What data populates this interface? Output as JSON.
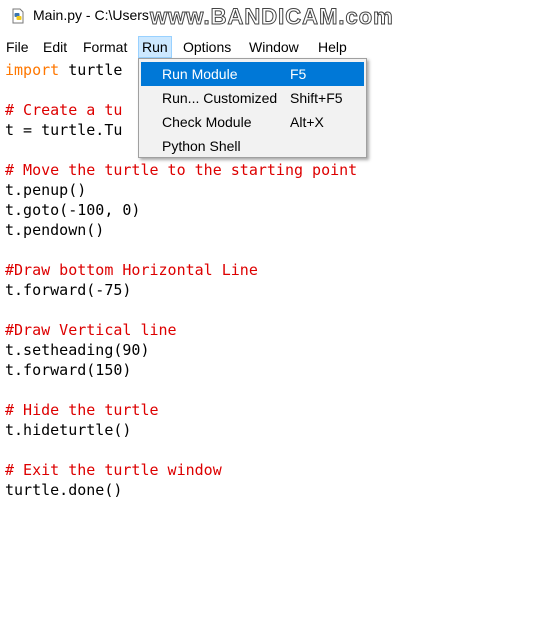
{
  "window": {
    "title": "Main.py - C:\\Users",
    "watermark": "www.BANDICAM.com"
  },
  "menubar": {
    "items": [
      {
        "label": "File"
      },
      {
        "label": "Edit"
      },
      {
        "label": "Format"
      },
      {
        "label": "Run"
      },
      {
        "label": "Options"
      },
      {
        "label": "Window"
      },
      {
        "label": "Help"
      }
    ]
  },
  "run_menu": {
    "items": [
      {
        "label": "Run Module",
        "accelerator": "F5"
      },
      {
        "label": "Run... Customized",
        "accelerator": "Shift+F5"
      },
      {
        "label": "Check Module",
        "accelerator": "Alt+X"
      },
      {
        "label": "Python Shell",
        "accelerator": ""
      }
    ]
  },
  "editor": {
    "lines": [
      {
        "kw": "import",
        "text": " turtle"
      },
      {
        "cm": "",
        "text": ""
      },
      {
        "cm": "# Create a tu",
        "text": ""
      },
      {
        "cm": "",
        "text": "t = turtle.Tu"
      },
      {
        "cm": "",
        "text": ""
      },
      {
        "cm": "# Move the turtle to the starting point",
        "text": ""
      },
      {
        "cm": "",
        "text": "t.penup()"
      },
      {
        "cm": "",
        "text": "t.goto(-100, 0)"
      },
      {
        "cm": "",
        "text": "t.pendown()"
      },
      {
        "cm": "",
        "text": ""
      },
      {
        "cm": "#Draw bottom Horizontal Line",
        "text": ""
      },
      {
        "cm": "",
        "text": "t.forward(-75)"
      },
      {
        "cm": "",
        "text": ""
      },
      {
        "cm": "#Draw Vertical line",
        "text": ""
      },
      {
        "cm": "",
        "text": "t.setheading(90)"
      },
      {
        "cm": "",
        "text": "t.forward(150)"
      },
      {
        "cm": "",
        "text": ""
      },
      {
        "cm": "# Hide the turtle",
        "text": ""
      },
      {
        "cm": "",
        "text": "t.hideturtle()"
      },
      {
        "cm": "",
        "text": ""
      },
      {
        "cm": "# Exit the turtle window",
        "text": ""
      },
      {
        "cm": "",
        "text": "turtle.done()"
      }
    ]
  },
  "colors": {
    "keyword": "#ff7700",
    "comment": "#dd0000",
    "menu_selected": "#0078d7",
    "menu_active": "#cce8ff"
  },
  "icons": {
    "app": "python-file-icon"
  }
}
